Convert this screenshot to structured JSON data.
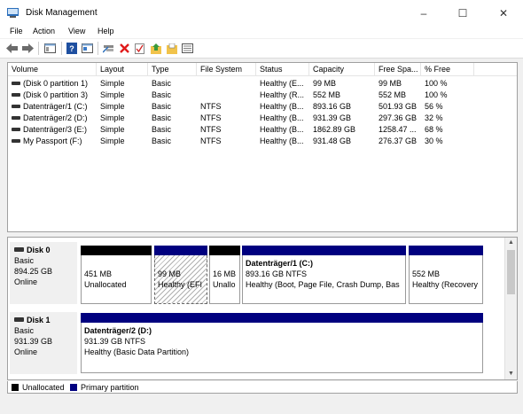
{
  "window": {
    "title": "Disk Management",
    "controls": [
      "–",
      "☐",
      "✕"
    ]
  },
  "menu": [
    "File",
    "Action",
    "View",
    "Help"
  ],
  "toolbar": [
    "back-icon",
    "forward-icon",
    "console-tree-icon",
    "help-icon",
    "properties-icon",
    "connect-icon",
    "delete-icon",
    "check-icon",
    "up-folder-icon",
    "open-folder-icon",
    "list-icon"
  ],
  "columns": [
    "Volume",
    "Layout",
    "Type",
    "File System",
    "Status",
    "Capacity",
    "Free Spa...",
    "% Free"
  ],
  "volumes": [
    {
      "volume": "(Disk 0 partition 1)",
      "layout": "Simple",
      "type": "Basic",
      "fs": "",
      "status": "Healthy (E...",
      "capacity": "99 MB",
      "free": "99 MB",
      "pct": "100 %"
    },
    {
      "volume": "(Disk 0 partition 3)",
      "layout": "Simple",
      "type": "Basic",
      "fs": "",
      "status": "Healthy (R...",
      "capacity": "552 MB",
      "free": "552 MB",
      "pct": "100 %"
    },
    {
      "volume": "Datenträger/1 (C:)",
      "layout": "Simple",
      "type": "Basic",
      "fs": "NTFS",
      "status": "Healthy (B...",
      "capacity": "893.16 GB",
      "free": "501.93 GB",
      "pct": "56 %"
    },
    {
      "volume": "Datenträger/2 (D:)",
      "layout": "Simple",
      "type": "Basic",
      "fs": "NTFS",
      "status": "Healthy (B...",
      "capacity": "931.39 GB",
      "free": "297.36 GB",
      "pct": "32 %"
    },
    {
      "volume": "Datenträger/3 (E:)",
      "layout": "Simple",
      "type": "Basic",
      "fs": "NTFS",
      "status": "Healthy (B...",
      "capacity": "1862.89 GB",
      "free": "1258.47 ...",
      "pct": "68 %"
    },
    {
      "volume": "My Passport (F:)",
      "layout": "Simple",
      "type": "Basic",
      "fs": "NTFS",
      "status": "Healthy (B...",
      "capacity": "931.48 GB",
      "free": "276.37 GB",
      "pct": "30 %"
    }
  ],
  "disk0": {
    "name": "Disk 0",
    "type": "Basic",
    "size": "894.25 GB",
    "state": "Online",
    "parts": [
      {
        "size": "451 MB",
        "status": "Unallocated"
      },
      {
        "size": "99 MB",
        "status": "Healthy (EFI"
      },
      {
        "size": "16 MB",
        "status": "Unallo"
      },
      {
        "name": "Datenträger/1  (C:)",
        "size": "893.16 GB NTFS",
        "status": "Healthy (Boot, Page File, Crash Dump, Bas"
      },
      {
        "size": "552 MB",
        "status": "Healthy (Recovery"
      }
    ]
  },
  "disk1": {
    "name": "Disk 1",
    "type": "Basic",
    "size": "931.39 GB",
    "state": "Online",
    "parts": [
      {
        "name": "Datenträger/2  (D:)",
        "size": "931.39 GB NTFS",
        "status": "Healthy (Basic Data Partition)"
      }
    ]
  },
  "legend": {
    "unallocated": "Unallocated",
    "primary": "Primary partition"
  },
  "colors": {
    "unallocated": "#000000",
    "primary": "#00007f"
  }
}
